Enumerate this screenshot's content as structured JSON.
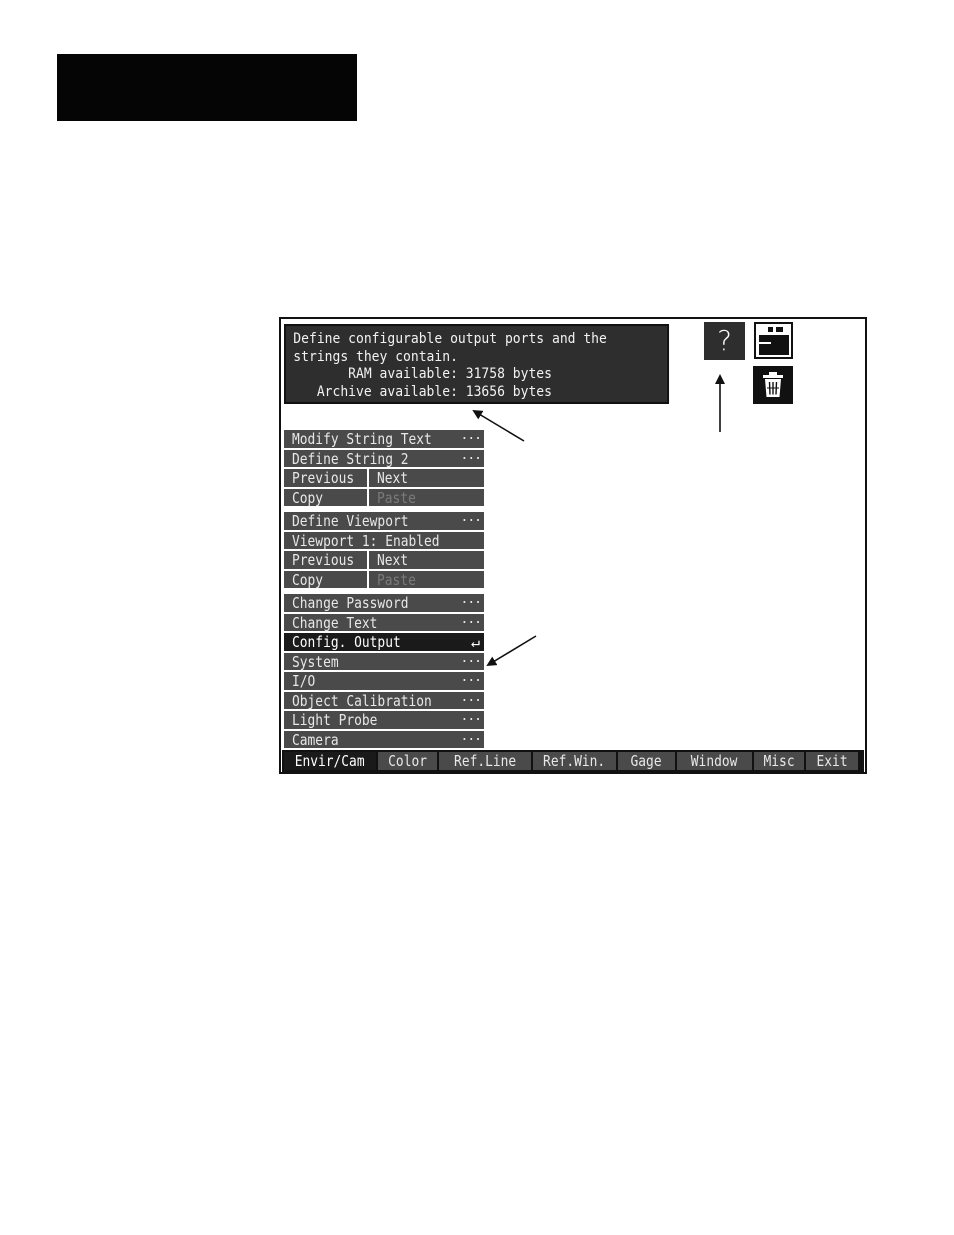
{
  "message": {
    "lines": [
      "Define configurable output ports and the",
      "strings they contain.",
      "       RAM available: 31758 bytes",
      "   Archive available: 13656 bytes"
    ]
  },
  "icons": {
    "help": "question-mark-icon",
    "window": "window-layout-icon",
    "trash": "trash-can-icon",
    "help_glyph": "?"
  },
  "menu_group1": {
    "modify_string_text": "Modify String Text",
    "define_string": "Define String 2",
    "previous": "Previous",
    "next": "Next",
    "copy": "Copy",
    "paste": "Paste"
  },
  "menu_group2": {
    "define_viewport": "Define Viewport",
    "viewport_status": "Viewport 1: Enabled",
    "previous": "Previous",
    "next": "Next",
    "copy": "Copy",
    "paste": "Paste"
  },
  "menu_group3": {
    "change_password": "Change Password",
    "change_text": "Change Text",
    "config_output": "Config. Output",
    "system": "System",
    "io": "I/O",
    "object_calibration": "Object Calibration",
    "light_probe": "Light Probe",
    "camera": "Camera"
  },
  "ellipsis": "...",
  "enter_glyph": "↵",
  "tabs": {
    "envir_cam": "Envir/Cam",
    "color": "Color",
    "ref_line": "Ref.Line",
    "ref_win": "Ref.Win.",
    "gage": "Gage",
    "window": "Window",
    "misc": "Misc",
    "exit": "Exit"
  }
}
